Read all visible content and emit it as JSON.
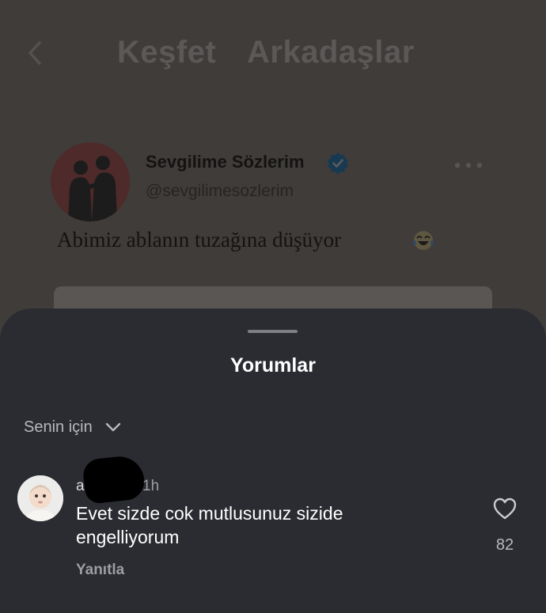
{
  "header": {
    "back_icon": "chevron-left-icon",
    "tabs": [
      {
        "label": "Keşfet"
      },
      {
        "label": "Arkadaşlar"
      }
    ]
  },
  "post": {
    "author_name": "Sevgilime Sözlerim",
    "verified_icon": "verified-badge-icon",
    "author_handle": "@sevgilimesozlerim",
    "more_icon": "more-horizontal-icon",
    "text": "Abimiz ablanın tuzağına düşüyor",
    "emoji_icon": "tears-of-joy-emoji-icon"
  },
  "comments_sheet": {
    "title": "Yorumlar",
    "filter_label": "Senin için",
    "comments": [
      {
        "user": "a",
        "time": "1h",
        "text": "Evet sizde cok mutlusunuz sizide engelliyorum",
        "reply_label": "Yanıtla",
        "like_icon": "heart-icon",
        "likes": "82"
      }
    ]
  },
  "colors": {
    "background_dim": "#3f3c3a",
    "sheet": "#2a2c31",
    "verified": "#1d9bf0"
  }
}
